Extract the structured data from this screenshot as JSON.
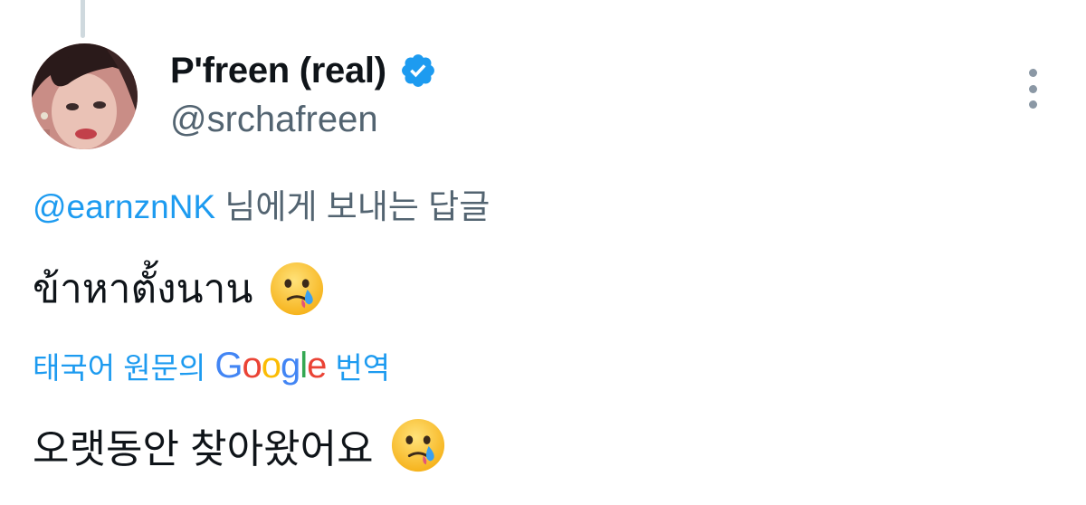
{
  "author": {
    "display_name": "P'freen (real)",
    "handle": "@srchafreen",
    "verified": true,
    "verified_color": "#1d9bf0",
    "avatar": "profile-photo"
  },
  "reply_context": {
    "mention": "@earnznNK",
    "suffix": " 님에게 보내는 답글"
  },
  "tweet": {
    "text": "ข้าหาตั้งนาน",
    "emoji": "face-holding-back-tears"
  },
  "translation": {
    "prefix": "태국어 원문의",
    "google_letters": [
      "G",
      "o",
      "o",
      "g",
      "l",
      "e"
    ],
    "suffix": "번역",
    "text": "오랫동안 찾아왔어요",
    "emoji": "face-holding-back-tears"
  },
  "colors": {
    "link": "#1d9bf0",
    "secondary_text": "#536471",
    "primary_text": "#0f1419"
  }
}
